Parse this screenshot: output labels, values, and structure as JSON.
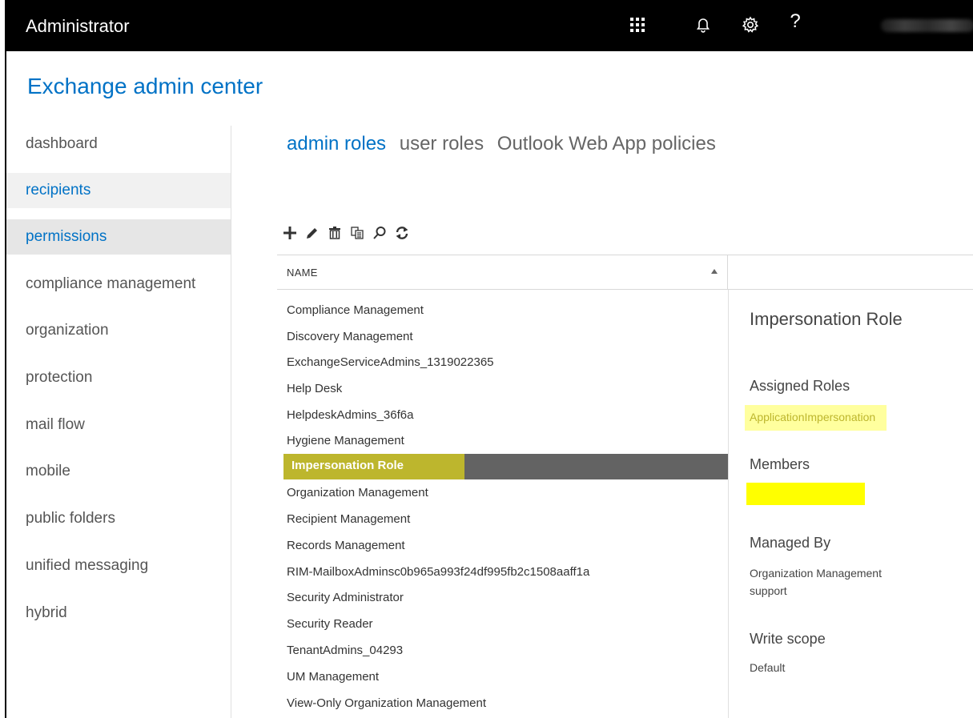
{
  "topbar": {
    "title": "Administrator",
    "icons": [
      "app-launcher-icon",
      "bell-icon",
      "gear-icon",
      "help-icon"
    ],
    "help_glyph": "?"
  },
  "app": {
    "title": "Exchange admin center"
  },
  "nav": {
    "items": [
      {
        "label": "dashboard"
      },
      {
        "label": "recipients"
      },
      {
        "label": "permissions"
      },
      {
        "label": "compliance management"
      },
      {
        "label": "organization"
      },
      {
        "label": "protection"
      },
      {
        "label": "mail flow"
      },
      {
        "label": "mobile"
      },
      {
        "label": "public folders"
      },
      {
        "label": "unified messaging"
      },
      {
        "label": "hybrid"
      }
    ],
    "selected": "permissions",
    "hover": "recipients"
  },
  "tabs": [
    {
      "label": "admin roles",
      "active": true
    },
    {
      "label": "user roles",
      "active": false
    },
    {
      "label": "Outlook Web App policies",
      "active": false
    }
  ],
  "toolbar": [
    "add-icon",
    "edit-icon",
    "delete-icon",
    "copy-icon",
    "search-icon",
    "refresh-icon"
  ],
  "list": {
    "column_name": "NAME",
    "rows": [
      "Compliance Management",
      "Discovery Management",
      "ExchangeServiceAdmins_1319022365",
      "Help Desk",
      "HelpdeskAdmins_36f6a",
      "Hygiene Management",
      "Impersonation Role",
      "Organization Management",
      "Recipient Management",
      "Records Management",
      "RIM-MailboxAdminsc0b965a993f24df995fb2c1508aaff1a",
      "Security Administrator",
      "Security Reader",
      "TenantAdmins_04293",
      "UM Management",
      "View-Only Organization Management"
    ],
    "selected_index": 6
  },
  "details": {
    "title": "Impersonation Role",
    "assigned_roles_label": "Assigned Roles",
    "assigned_roles_value": "ApplicationImpersonation",
    "members_label": "Members",
    "managed_by_label": "Managed By",
    "managed_by_values": [
      "Organization Management",
      "support"
    ],
    "write_scope_label": "Write scope",
    "write_scope_value": "Default"
  },
  "colors": {
    "topbar": "#000000",
    "accent": "#0072c6",
    "selected_row": "#636363",
    "highlight_olive": "#bdb62d",
    "highlight_yellow": "#ffff00",
    "highlight_pale_yellow": "#ffff9e"
  }
}
